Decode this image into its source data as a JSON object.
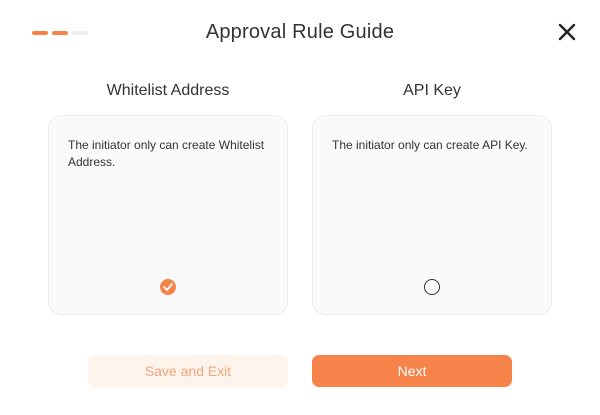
{
  "dialog": {
    "title": "Approval Rule Guide",
    "steps": {
      "total": 3,
      "current": 2
    }
  },
  "options": [
    {
      "heading": "Whitelist Address",
      "description": "The initiator only can create Whitelist Address.",
      "selected": true
    },
    {
      "heading": "API Key",
      "description": "The initiator only can create API Key.",
      "selected": false
    }
  ],
  "buttons": {
    "save_exit_label": "Save and Exit",
    "next_label": "Next"
  },
  "icons": {
    "close": "close-icon",
    "check": "check-icon"
  },
  "colors": {
    "accent": "#f5834a",
    "accent_light": "#fff4ec",
    "card_bg": "#fafafa",
    "step_inactive": "#eeeeee"
  }
}
